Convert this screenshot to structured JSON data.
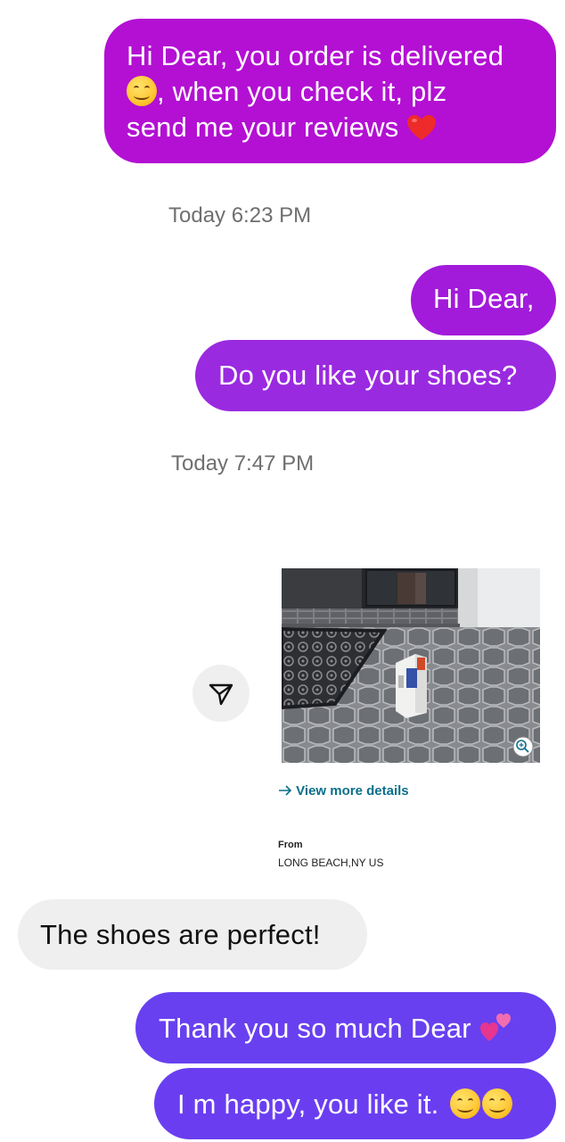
{
  "messages": {
    "m1_line1": "Hi Dear, you order is delivered",
    "m1_line2": ", when you check it, plz",
    "m1_line3": "send me your reviews",
    "m2": "Hi Dear,",
    "m3": "Do you like your shoes?",
    "m4": "The shoes are perfect!",
    "m5": "Thank you so much Dear",
    "m6": "I m happy, you like it."
  },
  "timestamps": {
    "t1": "Today 6:23 PM",
    "t2": "Today 7:47 PM"
  },
  "attachment": {
    "details_link": "View more details",
    "from_label": "From",
    "from_value": "LONG BEACH,NY US"
  },
  "icons": {
    "share": "share-send-icon",
    "zoom": "zoom-in-icon",
    "arrow": "arrow-right-icon",
    "smile": "smiling-face-emoji",
    "heart": "red-heart-emoji",
    "two_hearts": "two-hearts-emoji"
  },
  "colors": {
    "bubble_magenta": "#b312d2",
    "bubble_purple": "#9a2be0",
    "bubble_indigo": "#6a3ef0",
    "bubble_incoming": "#efefef",
    "link": "#0b6f8a"
  }
}
